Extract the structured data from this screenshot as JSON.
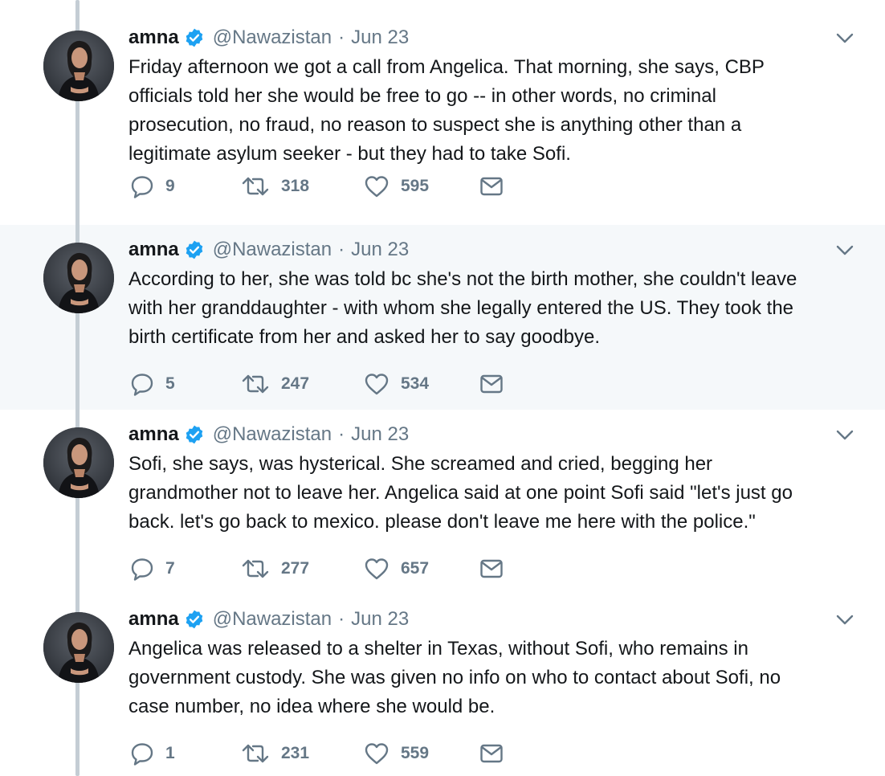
{
  "author": {
    "name": "amna",
    "handle": "@Nawazistan",
    "separator": "·"
  },
  "colors": {
    "text": "#14171a",
    "muted": "#657786",
    "verified": "#1da1f2",
    "highlight_bg": "#f5f8fa",
    "thread_line": "#c4cdd4"
  },
  "icons": [
    "verified-badge-icon",
    "caret-down-icon",
    "reply-icon",
    "retweet-icon",
    "like-icon",
    "direct-message-icon"
  ],
  "tweets": [
    {
      "date": "Jun 23",
      "lines": [
        "Friday afternoon we got a call from Angelica. That morning, she says, CBP",
        "officials told her she would be free to go -- in other words, no criminal",
        "prosecution, no fraud, no reason to suspect she is anything other than a",
        "legitimate asylum seeker - but they had to take Sofi."
      ],
      "replies": "9",
      "retweets": "318",
      "likes": "595"
    },
    {
      "date": "Jun 23",
      "lines": [
        "According to her, she was told bc she's not the birth mother, she couldn't leave",
        "with her granddaughter - with whom she legally entered the US. They took the",
        "birth certificate from her and asked her to say goodbye."
      ],
      "replies": "5",
      "retweets": "247",
      "likes": "534"
    },
    {
      "date": "Jun 23",
      "lines": [
        "Sofi, she says, was hysterical. She screamed and cried, begging her",
        "grandmother not to leave her. Angelica said at one point Sofi said \"let's just go",
        "back. let's go back to mexico. please don't leave me here with the police.\""
      ],
      "replies": "7",
      "retweets": "277",
      "likes": "657"
    },
    {
      "date": "Jun 23",
      "lines": [
        "Angelica was released to a shelter in Texas, without Sofi, who remains in",
        "government custody. She was given no info on who to contact about Sofi, no",
        "case number, no idea where she would be."
      ],
      "replies": "1",
      "retweets": "231",
      "likes": "559"
    }
  ]
}
